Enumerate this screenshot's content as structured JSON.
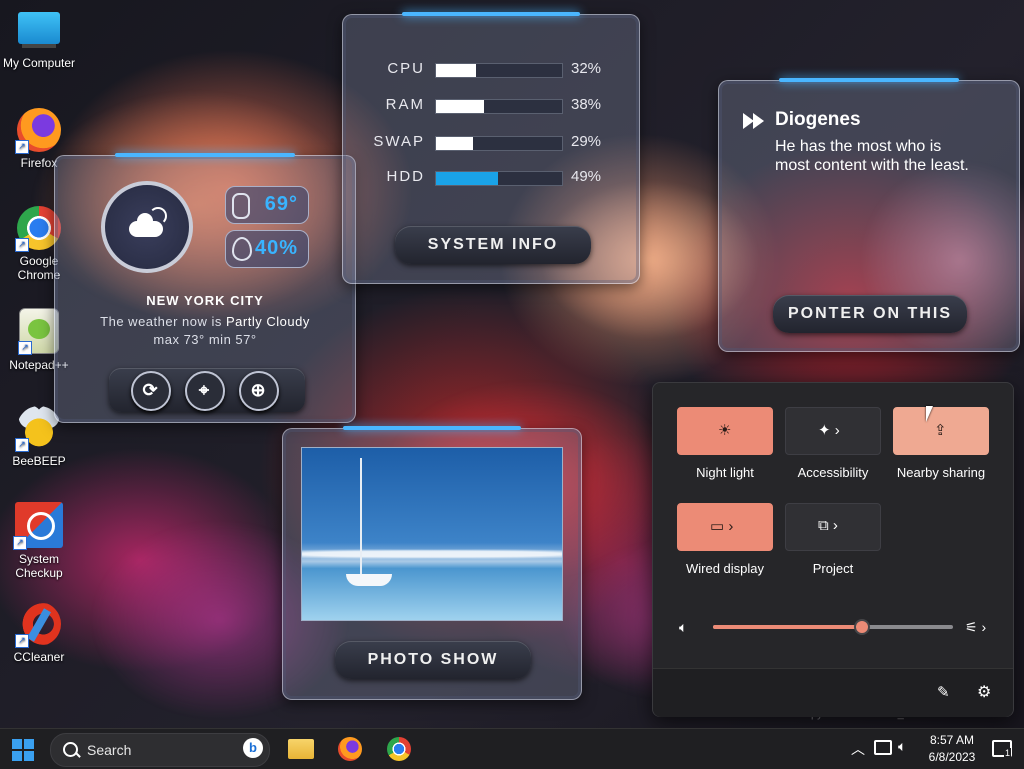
{
  "desktop_icons": [
    {
      "label": "My Computer"
    },
    {
      "label": "Firefox"
    },
    {
      "label": "Google Chrome"
    },
    {
      "label": "Notepad++"
    },
    {
      "label": "BeeBEEP"
    },
    {
      "label": "System Checkup"
    },
    {
      "label": "CCleaner"
    }
  ],
  "weather": {
    "temp": "69°",
    "humidity": "40%",
    "city": "NEW YORK CITY",
    "desc_prefix": "The weather now is ",
    "desc_value": "Partly Cloudy",
    "minmax": "max 73° min 57°"
  },
  "sysinfo": {
    "rows": [
      {
        "label": "CPU",
        "pct": "32%",
        "value": 32,
        "color": "#ffffff"
      },
      {
        "label": "RAM",
        "pct": "38%",
        "value": 38,
        "color": "#ffffff"
      },
      {
        "label": "SWAP",
        "pct": "29%",
        "value": 29,
        "color": "#ffffff"
      },
      {
        "label": "HDD",
        "pct": "49%",
        "value": 49,
        "color": "#1aa3e8"
      }
    ],
    "button": "SYSTEM INFO"
  },
  "quote": {
    "author": "Diogenes",
    "text": "He has the most who is most content with the least.",
    "button": "PONTER ON THIS"
  },
  "photo": {
    "button": "PHOTO SHOW"
  },
  "quick_settings": {
    "tiles": [
      {
        "label": "Night light",
        "icon": "night-light-icon",
        "state": "on"
      },
      {
        "label": "Accessibility",
        "icon": "accessibility-icon",
        "state": "off"
      },
      {
        "label": "Nearby sharing",
        "icon": "share-icon",
        "state": "soft"
      },
      {
        "label": "Wired display",
        "icon": "cast-icon",
        "state": "on"
      },
      {
        "label": "Project",
        "icon": "project-icon",
        "state": "off"
      }
    ],
    "volume": 62,
    "accent": "#ec8b76"
  },
  "watermark": "Evaluation copy. Build 23493.ni_release 230531-1435",
  "taskbar": {
    "search_placeholder": "Search",
    "time": "8:57 AM",
    "date": "6/8/2023",
    "notification_count": "1"
  }
}
